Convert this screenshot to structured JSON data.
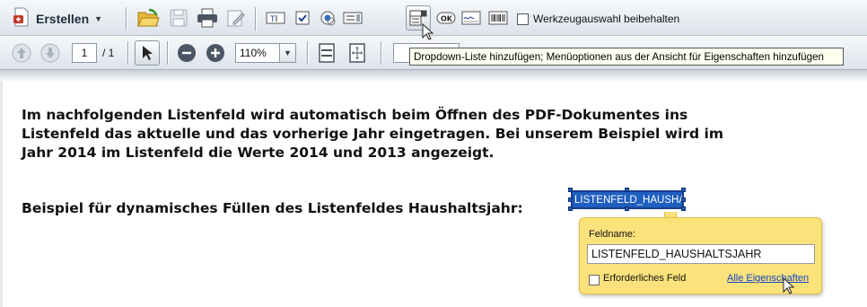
{
  "toolbar_top": {
    "create_label": "Erstellen",
    "tool_icons": [
      "open-folder-icon",
      "save-icon",
      "print-icon",
      "edit-sign-icon",
      "text-field-icon",
      "checkbox-icon",
      "radio-button-icon",
      "list-box-icon",
      "dropdown-list-icon",
      "ok-button-icon",
      "signature-field-icon",
      "barcode-icon"
    ],
    "keep_tool_checked": false,
    "keep_tool_label": "Werkzeugauswahl beibehalten"
  },
  "toolbar_nav": {
    "current_page": "1",
    "page_total": "/ 1",
    "zoom": "110%"
  },
  "tooltip": "Dropdown-Liste hinzufügen; Menüoptionen aus der Ansicht für Eigenschaften hinzufügen",
  "document": {
    "paragraph_lines": [
      "Im nachfolgenden Listenfeld wird automatisch beim Öffnen des PDF-Dokumentes ins",
      "Listenfeld das aktuelle und das vorherige Jahr eingetragen. Bei unserem Beispiel wird im",
      "Jahr 2014 im Listenfeld die Werte 2014 und 2013 angezeigt."
    ],
    "example_label": "Beispiel für dynamisches Füllen des Listenfeldes Haushaltsjahr:",
    "list_field_text": "LISTENFELD_HAUSHA"
  },
  "popup": {
    "field_name_label": "Feldname:",
    "field_name_value": "LISTENFELD_HAUSHALTSJAHR",
    "required_checked": false,
    "required_label": "Erforderliches Feld",
    "all_properties_link": "Alle Eigenschaften"
  },
  "colors": {
    "selection_blue": "#1f5fbf",
    "popup_yellow": "#fbe27a",
    "link_blue": "#1446c8"
  }
}
